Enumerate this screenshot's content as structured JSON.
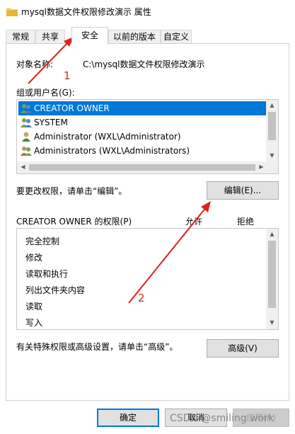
{
  "window": {
    "title": "mysql数据文件权限修改演示 属性"
  },
  "tabs": [
    {
      "label": "常规"
    },
    {
      "label": "共享"
    },
    {
      "label": "安全"
    },
    {
      "label": "以前的版本"
    },
    {
      "label": "自定义"
    }
  ],
  "security": {
    "object_name_label": "对象名称:",
    "object_name_value": "C:\\mysql数据文件权限修改演示",
    "group_label": "组或用户名(G):",
    "users": [
      {
        "name": "CREATOR OWNER",
        "icon": "users-group-icon"
      },
      {
        "name": "SYSTEM",
        "icon": "users-group-icon"
      },
      {
        "name": "Administrator (WXL\\Administrator)",
        "icon": "user-icon"
      },
      {
        "name": "Administrators (WXL\\Administrators)",
        "icon": "users-group-icon"
      }
    ],
    "edit_hint": "要更改权限，请单击“编辑”。",
    "edit_button": "编辑(E)...",
    "perm_title": "CREATOR OWNER 的权限(P)",
    "allow_header": "允许",
    "deny_header": "拒绝",
    "permissions": [
      "完全控制",
      "修改",
      "读取和执行",
      "列出文件夹内容",
      "读取",
      "写入"
    ],
    "advanced_hint": "有关特殊权限或高级设置，请单击“高级”。",
    "advanced_button": "高级(V)"
  },
  "footer": {
    "ok": "确定",
    "cancel": "取消",
    "apply": "应用(A)"
  },
  "annotations": {
    "one": "1",
    "two": "2"
  },
  "watermark": "CSDN @smiling work",
  "colors": {
    "selection": "#0078d7",
    "annotation": "#e02020"
  }
}
